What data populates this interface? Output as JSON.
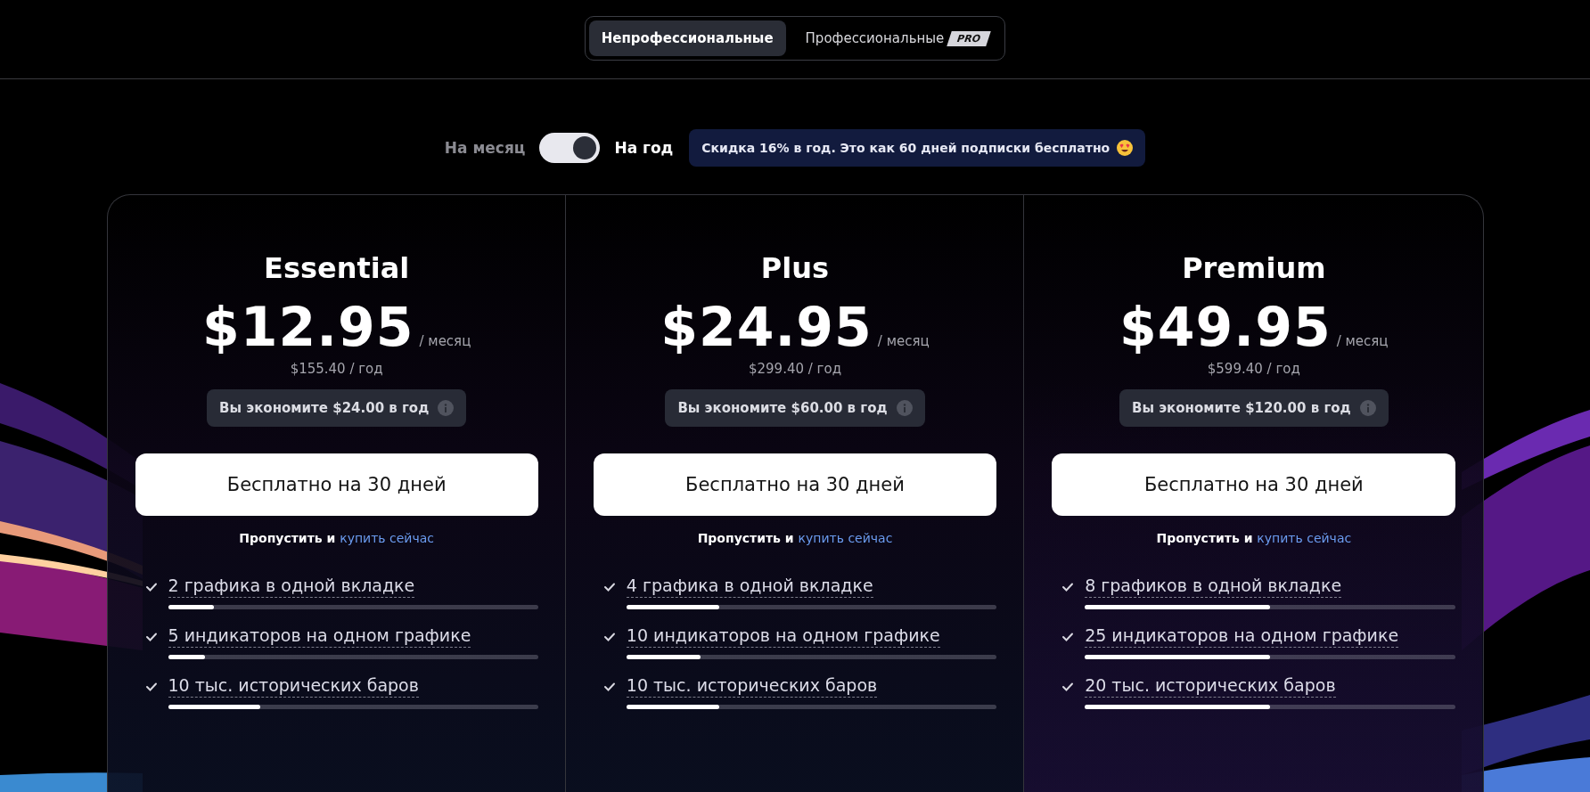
{
  "segment_tabs": [
    {
      "label": "Непрофессиональные",
      "selected": true
    },
    {
      "label": "Профессиональные",
      "badge": "PRO",
      "selected": false
    }
  ],
  "billing": {
    "monthly_label": "На месяц",
    "yearly_label": "На год",
    "yearly": true,
    "discount_note": "Скидка 16% в год. Это как 60 дней подписки бесплатно"
  },
  "plans": [
    {
      "name": "Essential",
      "price": "$12.95",
      "period": "/ месяц",
      "yearly_price": "$155.40 / год",
      "savings": "Вы экономите $24.00 в год",
      "cta": "Бесплатно на 30 дней",
      "skip_text": "Пропустить и",
      "skip_link": "купить сейчас",
      "features": [
        {
          "text": "2 графика в одной вкладке",
          "level": 0.125
        },
        {
          "text": "5 индикаторов на одном графике",
          "level": 0.1
        },
        {
          "text": "10 тыс. исторических баров",
          "level": 0.25
        }
      ]
    },
    {
      "name": "Plus",
      "price": "$24.95",
      "period": "/ месяц",
      "yearly_price": "$299.40 / год",
      "savings": "Вы экономите $60.00 в год",
      "cta": "Бесплатно на 30 дней",
      "skip_text": "Пропустить и",
      "skip_link": "купить сейчас",
      "features": [
        {
          "text": "4 графика в одной вкладке",
          "level": 0.25
        },
        {
          "text": "10 индикаторов на одном графике",
          "level": 0.2
        },
        {
          "text": "10 тыс. исторических баров",
          "level": 0.25
        }
      ]
    },
    {
      "name": "Premium",
      "price": "$49.95",
      "period": "/ месяц",
      "yearly_price": "$599.40 / год",
      "savings": "Вы экономите $120.00 в год",
      "cta": "Бесплатно на 30 дней",
      "skip_text": "Пропустить и",
      "skip_link": "купить сейчас",
      "features": [
        {
          "text": "8 графиков в одной вкладке",
          "level": 0.5
        },
        {
          "text": "25 индикаторов на одном графике",
          "level": 0.5
        },
        {
          "text": "20 тыс. исторических баров",
          "level": 0.5
        }
      ]
    }
  ]
}
